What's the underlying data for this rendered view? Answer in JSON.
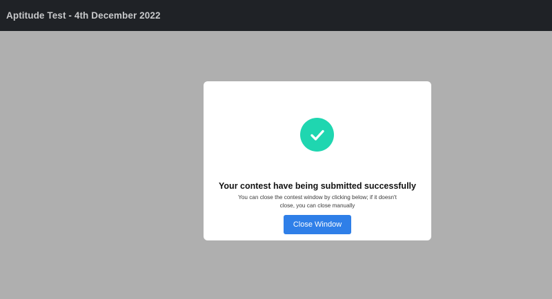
{
  "header": {
    "title": "Aptitude Test - 4th December 2022"
  },
  "modal": {
    "icon": "check-circle-icon",
    "heading": "Your contest have being submitted successfully",
    "subtext_line1": "You can close the contest window by clicking below; if it doesn't",
    "subtext_line2": "close, you can close manually",
    "button_label": "Close Window"
  },
  "colors": {
    "header_bg": "#1f2226",
    "backdrop": "#afafaf",
    "success": "#1fd6b0",
    "button": "#2f7fe8"
  }
}
